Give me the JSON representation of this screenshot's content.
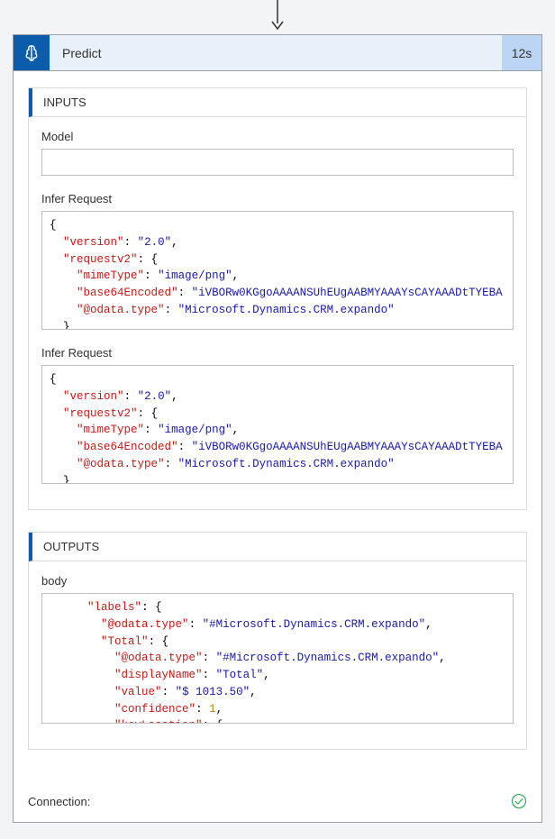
{
  "header": {
    "title": "Predict",
    "duration": "12s"
  },
  "inputs": {
    "section_label": "INPUTS",
    "model_label": "Model",
    "model_value": "",
    "infer1_label": "Infer Request",
    "infer1_code": {
      "version_key": "version",
      "version_val": "2.0",
      "requestv2_key": "requestv2",
      "mimeType_key": "mimeType",
      "mimeType_val": "image/png",
      "base64_key": "base64Encoded",
      "base64_val": "iVBORw0KGgoAAAANSUhEUgAABMYAAAYsCAYAAADtTYEBA",
      "odata_key": "@odata.type",
      "odata_val": "Microsoft.Dynamics.CRM.expando"
    },
    "infer2_label": "Infer Request",
    "infer2_code": {
      "version_key": "version",
      "version_val": "2.0",
      "requestv2_key": "requestv2",
      "mimeType_key": "mimeType",
      "mimeType_val": "image/png",
      "base64_key": "base64Encoded",
      "base64_val": "iVBORw0KGgoAAAANSUhEUgAABMYAAAYsCAYAAADtTYEBA",
      "odata_key": "@odata.type",
      "odata_val": "Microsoft.Dynamics.CRM.expando"
    }
  },
  "outputs": {
    "section_label": "OUTPUTS",
    "body_label": "body",
    "body_code": {
      "labels_key": "labels",
      "odata_key": "@odata.type",
      "odata_val": "#Microsoft.Dynamics.CRM.expando",
      "total_key": "Total",
      "displayName_key": "displayName",
      "displayName_val": "Total",
      "value_key": "value",
      "value_val": "$ 1013.50",
      "confidence_key": "confidence",
      "confidence_val": "1",
      "keyLocation_key": "keyLocation"
    }
  },
  "footer": {
    "connection_label": "Connection:"
  }
}
